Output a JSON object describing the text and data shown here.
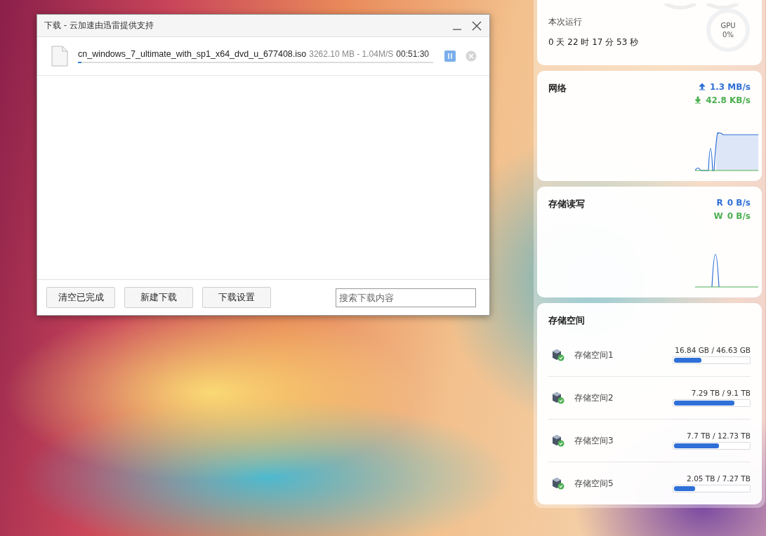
{
  "download_window": {
    "title": "下载 - 云加速由迅雷提供支持",
    "tasks": [
      {
        "filename": "cn_windows_7_ultimate_with_sp1_x64_dvd_u_677408.iso",
        "details": "3262.10 MB - 1.04M/S",
        "time_left": "00:51:30",
        "level": 0.01
      }
    ],
    "buttons": [
      "清空已完成",
      "新建下载",
      "下载设置"
    ],
    "search": {
      "placeholder": "搜索下载内容"
    }
  },
  "monitor": {
    "uptime": {
      "label": "本次运行",
      "value": "0 天 22 时 17 分 53 秒",
      "gpu": {
        "label": "GPU",
        "value": "0%",
        "level": 0
      }
    },
    "network": {
      "title": "网络",
      "upload": "1.3 MB/s",
      "download": "42.8 KB/s"
    },
    "disk_io": {
      "title": "存储读写",
      "read_label": "R",
      "read": "0 B/s",
      "write_label": "W",
      "write": "0 B/s"
    },
    "storage": {
      "title": "存储空间",
      "volumes": [
        {
          "name": "存储空间1",
          "usage": "16.84 GB / 46.63 GB",
          "level": 0.36
        },
        {
          "name": "存储空间2",
          "usage": "7.29 TB / 9.1 TB",
          "level": 0.8
        },
        {
          "name": "存储空间3",
          "usage": "7.7 TB / 12.73 TB",
          "level": 0.6
        },
        {
          "name": "存储空间5",
          "usage": "2.05 TB / 7.27 TB",
          "level": 0.28
        }
      ]
    }
  }
}
